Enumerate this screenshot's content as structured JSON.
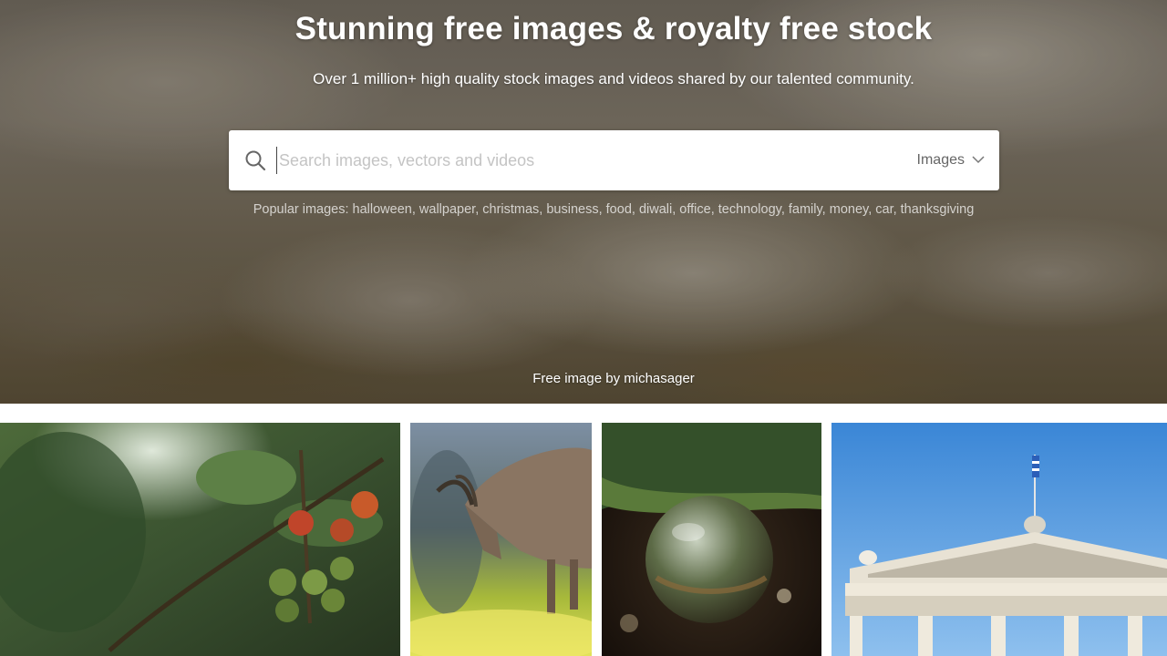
{
  "hero": {
    "title": "Stunning free images & royalty free stock",
    "subtitle": "Over 1 million+ high quality stock images and videos shared by our talented community.",
    "credit_prefix": "Free image by ",
    "credit_author": "michasager"
  },
  "search": {
    "placeholder": "Search images, vectors and videos",
    "type_selected": "Images",
    "icon": "search-icon"
  },
  "popular": {
    "label": "Popular images:",
    "tags": [
      "halloween",
      "wallpaper",
      "christmas",
      "business",
      "food",
      "diwali",
      "office",
      "technology",
      "family",
      "money",
      "car",
      "thanksgiving"
    ]
  },
  "gallery": {
    "tiles": [
      {
        "subject": "tomatoes-on-vine"
      },
      {
        "subject": "ibex-grazing"
      },
      {
        "subject": "crystal-ball-forest"
      },
      {
        "subject": "neoclassical-building-flag"
      }
    ]
  },
  "colors": {
    "hero_fog": "#7b7366",
    "search_bg": "#ffffff",
    "text_light": "#ffffff"
  }
}
